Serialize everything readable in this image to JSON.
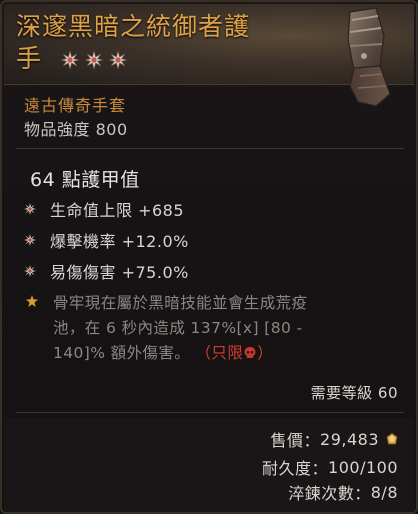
{
  "item": {
    "name_line1": "深邃黑暗之統御者護",
    "name_line2": "手",
    "type": "遠古傳奇手套",
    "item_power": "物品強度 800",
    "armor": "64 點護甲值"
  },
  "colors": {
    "title": "#dfa046",
    "type": "#c98a3a",
    "legendary_text": "#8b8680",
    "unique_tag": "#d43b2c"
  },
  "affixes": [
    {
      "text": "生命值上限 +685"
    },
    {
      "text": "爆擊機率 +12.0%"
    },
    {
      "text": "易傷傷害 +75.0%"
    }
  ],
  "legendary": {
    "line1": "骨牢現在屬於黑暗技能並會生成荒疫",
    "line2": "池，在 6 秒內造成 137%[x] [80 -",
    "line3": "140]% 額外傷害。",
    "tag_open": "（只限",
    "tag_close": "）"
  },
  "requirement": "需要等級 60",
  "footer": {
    "sell_label": "售價：",
    "sell_value": "29,483",
    "durability_label": "耐久度：",
    "durability_value": "100/100",
    "temper_label": "淬鍊次數：",
    "temper_value": "8/8"
  },
  "icons": {
    "rank_star": "masterwork-star-icon",
    "affix_bullet": "affix-bullet-icon",
    "legendary_bullet": "legendary-star-icon",
    "class_restriction": "skull-class-icon",
    "gold": "gold-coin-icon"
  },
  "masterwork_stars": 3
}
